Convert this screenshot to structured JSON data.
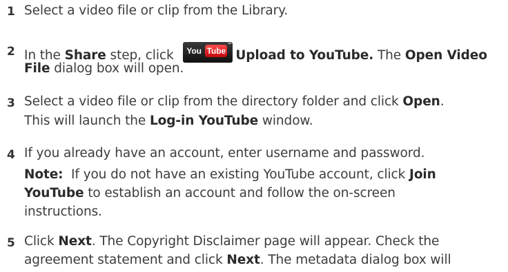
{
  "steps": [
    {
      "number": "1",
      "line1": "Select a video file or clip from the Library."
    },
    {
      "number": "2",
      "line1_a": "In the ",
      "share": "Share",
      "line1_b": " step, click ",
      "upload": "Upload to YouTube.",
      "line1_c": " The ",
      "open_video": "Open Video",
      "line2_file": "File",
      "line2_rest": " dialog box will open.",
      "logo": {
        "you": "You",
        "tube": "Tube",
        "tm": "™"
      }
    },
    {
      "number": "3",
      "line1_a": "Select a video file or clip from the directory folder and click ",
      "open": "Open",
      "line1_b": ".",
      "line2_a": "This will launch the ",
      "login": "Log-in YouTube",
      "line2_b": " window."
    },
    {
      "number": "4",
      "line1": "If you already have an account, enter username and password.",
      "note_label": "Note:",
      "note_a": "  If you do not have an existing YouTube account, click ",
      "join": "Join",
      "line4_join2": "YouTube",
      "line4_rest": " to establish an account and follow the on-screen",
      "line5": "instructions."
    },
    {
      "number": "5",
      "line1_a": "Click ",
      "next1": "Next",
      "line1_b": ". The Copyright Disclaimer page will appear. Check the",
      "line2_a": "agreement statement and click ",
      "next2": "Next",
      "line2_b": ". The metadata dialog box will"
    }
  ]
}
